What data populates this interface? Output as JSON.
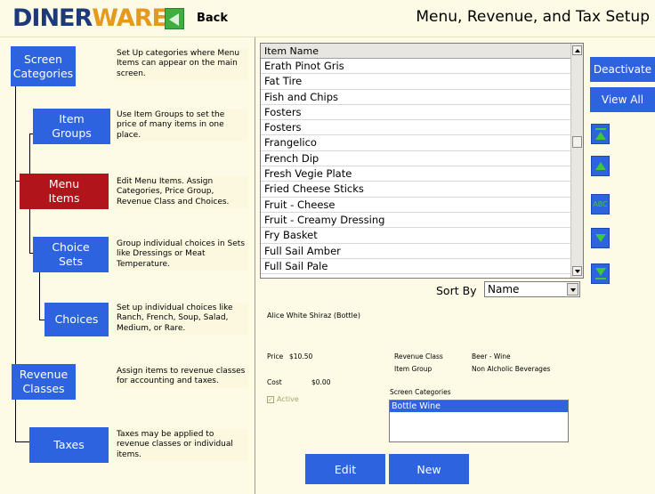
{
  "header": {
    "logo_part1": "DINER",
    "logo_part2": "WARE",
    "logo_mark": "®",
    "back_label": "Back",
    "title": "Menu, Revenue, and Tax Setup"
  },
  "nav": [
    {
      "label": "Screen\nCategories",
      "description": "Set Up categories where Menu Items can appear on the main screen.",
      "active": false
    },
    {
      "label": "Item\nGroups",
      "description": "Use Item Groups to set the price of many items in one place.",
      "active": false
    },
    {
      "label": "Menu\nItems",
      "description": "Edit Menu Items.  Assign Categories, Price Group, Revenue Class and Choices.",
      "active": true
    },
    {
      "label": "Choice\nSets",
      "description": "Group individual choices in Sets like Dressings or Meat Temperature.",
      "active": false
    },
    {
      "label": "Choices",
      "description": "Set up individual choices like Ranch, French, Soup, Salad, Medium, or Rare.",
      "active": false
    },
    {
      "label": "Revenue\nClasses",
      "description": "Assign items to revenue classes for accounting and taxes.",
      "active": false
    },
    {
      "label": "Taxes",
      "description": "Taxes may be applied to revenue classes or individual items.",
      "active": false
    }
  ],
  "list": {
    "header": "Item Name",
    "items": [
      "Erath Pinot Gris",
      "Fat Tire",
      "Fish and Chips",
      "Fosters",
      "Fosters",
      "Frangelico",
      "French Dip",
      "Fresh Vegie Plate",
      "Fried Cheese Sticks",
      "Fruit - Cheese",
      "Fruit - Creamy Dressing",
      "Fry Basket",
      "Full Sail Amber",
      "Full Sail Pale"
    ]
  },
  "side_buttons": {
    "deactivate": "Deactivate",
    "view_all": "View All",
    "abc": "ABC"
  },
  "sort": {
    "label": "Sort By",
    "value": "Name"
  },
  "details": {
    "item_name": "Alice White Shiraz (Bottle)",
    "price_label": "Price",
    "price_value": "$10.50",
    "cost_label": "Cost",
    "cost_value": "$0.00",
    "active_label": "Active",
    "active_checked": true,
    "revenue_class_label": "Revenue Class",
    "revenue_class_value": "Beer - Wine",
    "item_group_label": "Item Group",
    "item_group_value": "Non Alcholic Beverages",
    "screen_categories_label": "Screen Categories",
    "screen_categories": [
      "Bottle Wine"
    ]
  },
  "bottom_buttons": {
    "edit": "Edit",
    "new": "New"
  },
  "colors": {
    "accent": "#2e63e0",
    "active_nav": "#b2141b",
    "background": "#fdfbe6",
    "arrow": "#3fc63f"
  }
}
